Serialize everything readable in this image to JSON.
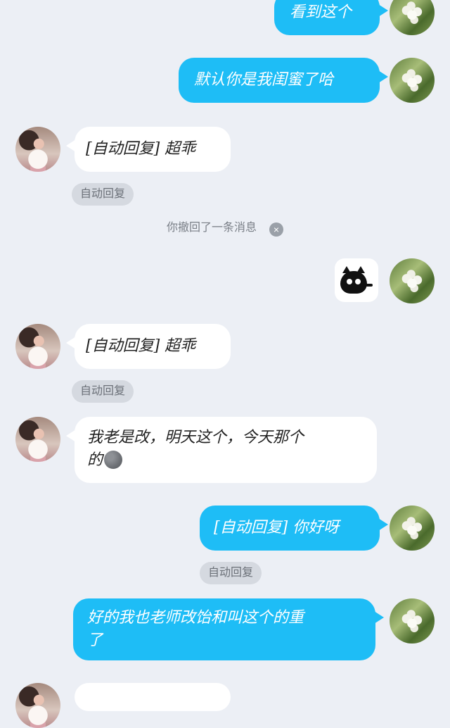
{
  "messages": {
    "m1": "看到这个",
    "m2": "默认你是我闺蜜了哈",
    "m3": "[自动回复] 超乖",
    "m4": "[自动回复] 超乖",
    "m5_line1": "我老是改，明天这个，今天那个",
    "m5_line2": "的",
    "m6": "[自动回复] 你好呀",
    "m7_line1": "好的我也老师改饴和叫这个的重",
    "m7_line2": "了"
  },
  "tags": {
    "auto_reply_1": "自动回复",
    "auto_reply_2": "自动回复",
    "auto_reply_3": "自动回复"
  },
  "system": {
    "recall_notice": "你撤回了一条消息",
    "recall_close": "×"
  },
  "icons": {
    "self_avatar": "flower-avatar-icon",
    "other_avatar": "girl-avatar-icon",
    "sticker": "black-cat-sticker-icon",
    "moon": "new-moon-emoji-icon"
  },
  "colors": {
    "background": "#eceff5",
    "self_bubble": "#1ebdf6",
    "other_bubble": "#ffffff",
    "tag_bg": "#d5d9e0"
  }
}
